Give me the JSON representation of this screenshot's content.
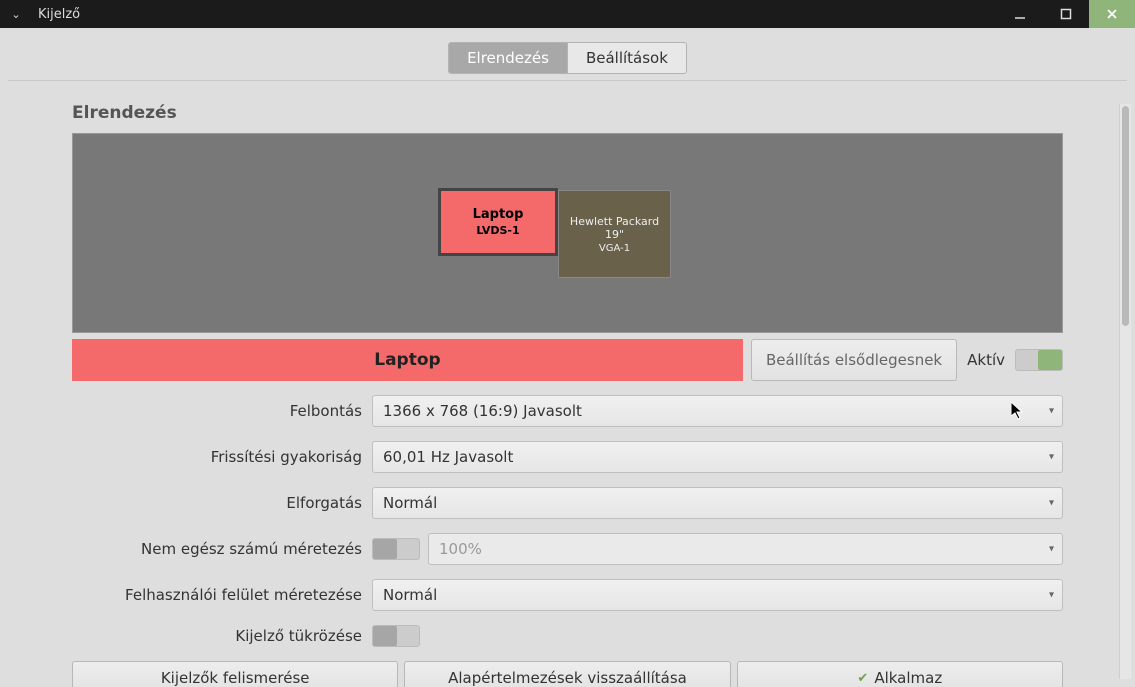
{
  "window": {
    "title": "Kijelző"
  },
  "tabs": {
    "layout": "Elrendezés",
    "settings": "Beállítások"
  },
  "section_title": "Elrendezés",
  "displays": {
    "laptop": {
      "name": "Laptop",
      "port": "LVDS-1"
    },
    "external": {
      "name": "Hewlett Packard 19\"",
      "port": "VGA-1"
    }
  },
  "selected": {
    "name": "Laptop",
    "set_primary": "Beállítás elsődlegesnek",
    "active_label": "Aktív"
  },
  "labels": {
    "resolution": "Felbontás",
    "refresh": "Frissítési gyakoriság",
    "rotation": "Elforgatás",
    "fractional": "Nem egész számú méretezés",
    "ui_scale": "Felhasználói felület méretezése",
    "mirror": "Kijelző tükrözése"
  },
  "values": {
    "resolution": "1366 x 768 (16:9)  Javasolt",
    "refresh": "60,01 Hz  Javasolt",
    "rotation": "Normál",
    "fractional_pct": "100%",
    "ui_scale": "Normál"
  },
  "buttons": {
    "identify": "Kijelzők felismerése",
    "reset": "Alapértelmezések visszaállítása",
    "apply": "Alkalmaz"
  }
}
